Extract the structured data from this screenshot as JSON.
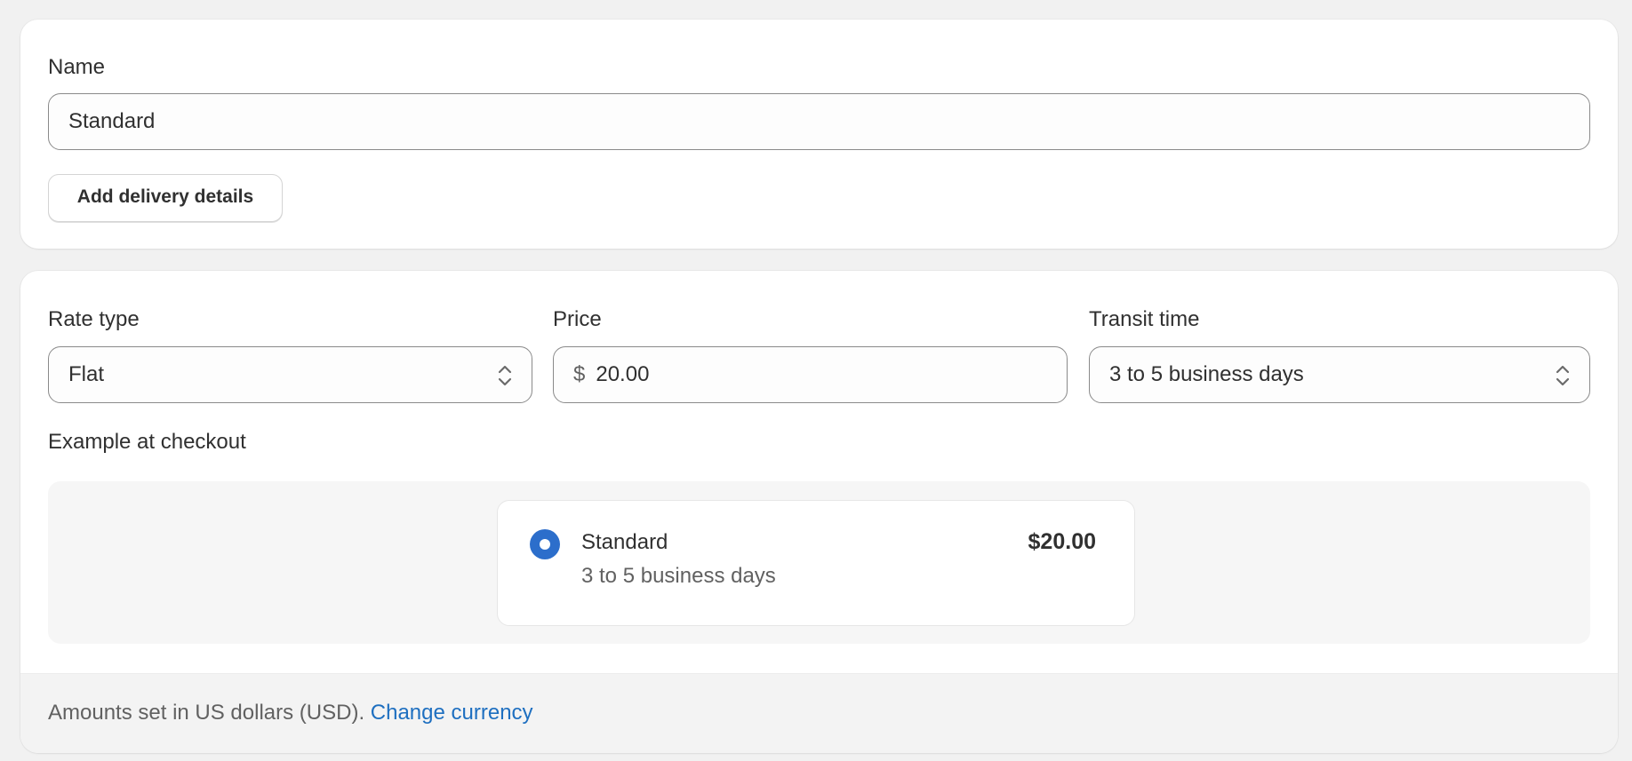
{
  "name_section": {
    "label": "Name",
    "value": "Standard",
    "add_details_button": "Add delivery details"
  },
  "rate_section": {
    "rate_type": {
      "label": "Rate type",
      "value": "Flat"
    },
    "price": {
      "label": "Price",
      "currency_symbol": "$",
      "value": "20.00"
    },
    "transit_time": {
      "label": "Transit time",
      "value": "3 to 5 business days"
    },
    "example_label": "Example at checkout",
    "example": {
      "name": "Standard",
      "transit": "3 to 5 business days",
      "price": "$20.00"
    }
  },
  "footer": {
    "text": "Amounts set in US dollars (USD).",
    "link": "Change currency"
  },
  "colors": {
    "accent": "#2c6ecb",
    "link": "#1e6fc0",
    "background": "#f1f1f1"
  },
  "icons": {
    "select_chevron": "chevron-up-down-icon",
    "radio_selected": "radio-selected-icon"
  }
}
